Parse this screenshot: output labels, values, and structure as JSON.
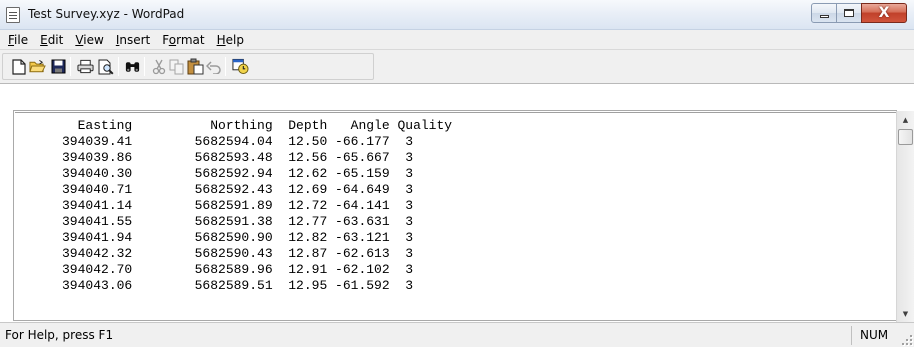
{
  "window": {
    "title": "Test Survey.xyz - WordPad",
    "close_label": "X"
  },
  "menu": {
    "items": [
      {
        "accel": "F",
        "rest": "ile"
      },
      {
        "accel": "E",
        "rest": "dit"
      },
      {
        "accel": "V",
        "rest": "iew"
      },
      {
        "accel": "I",
        "rest": "nsert"
      },
      {
        "pre": "F",
        "accel": "o",
        "rest": "rmat"
      },
      {
        "accel": "H",
        "rest": "elp"
      }
    ]
  },
  "toolbar": {
    "icons": [
      "new-document-icon",
      "open-folder-icon",
      "save-disk-icon",
      "print-icon",
      "print-preview-icon",
      "find-binoculars-icon",
      "cut-scissors-icon",
      "copy-icon",
      "paste-icon",
      "undo-icon",
      "insert-datetime-icon"
    ]
  },
  "document": {
    "lines": [
      "       Easting          Northing  Depth   Angle Quality",
      "     394039.41        5682594.04  12.50 -66.177  3",
      "     394039.86        5682593.48  12.56 -65.667  3",
      "     394040.30        5682592.94  12.62 -65.159  3",
      "     394040.71        5682592.43  12.69 -64.649  3",
      "     394041.14        5682591.89  12.72 -64.141  3",
      "     394041.55        5682591.38  12.77 -63.631  3",
      "     394041.94        5682590.90  12.82 -63.121  3",
      "     394042.32        5682590.43  12.87 -62.613  3",
      "     394042.70        5682589.96  12.91 -62.102  3",
      "     394043.06        5682589.51  12.95 -61.592  3"
    ]
  },
  "status": {
    "help_text": "For Help, press F1",
    "num_indicator": "NUM"
  }
}
